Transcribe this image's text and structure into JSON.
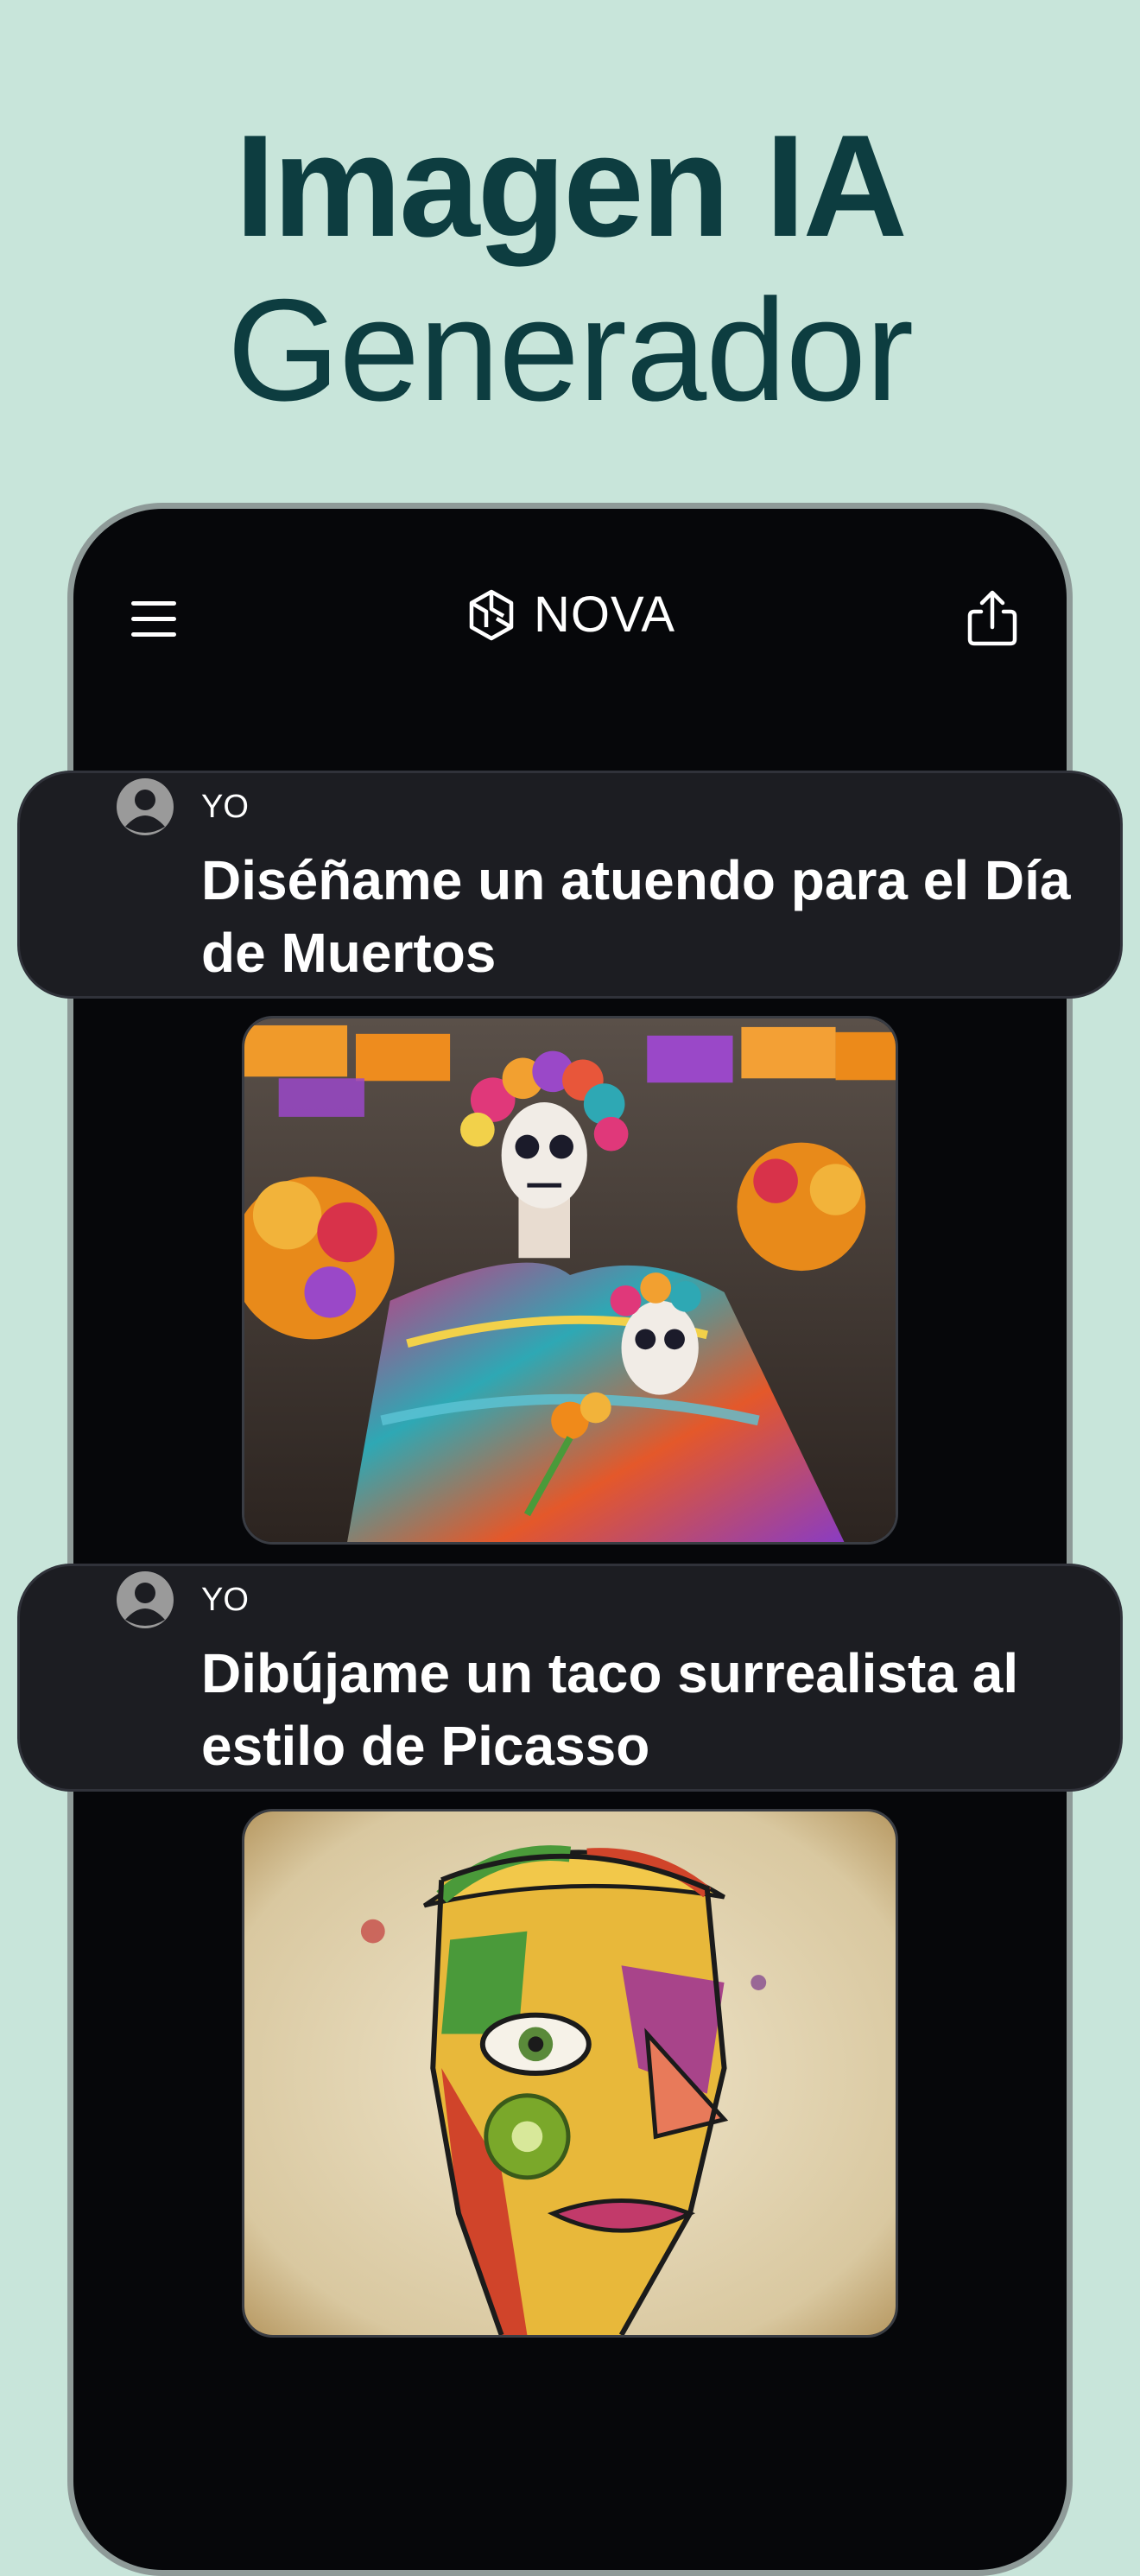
{
  "hero": {
    "title": "Imagen IA",
    "subtitle": "Generador"
  },
  "app": {
    "name": "NOVA",
    "icons": {
      "menu": "hamburger-menu-icon",
      "logo": "nova-logo-icon",
      "share": "share-icon",
      "avatar": "user-avatar-icon"
    }
  },
  "chat": {
    "messages": [
      {
        "sender": "YO",
        "prompt": "Diséñame un atuendo para el Día de Muertos",
        "image": "Catrina in floral dress with skull mask and marigolds"
      },
      {
        "sender": "YO",
        "prompt": "Dibújame un taco surrealista al estilo de Picasso",
        "image": "Cubist surreal taco face illustration"
      }
    ]
  },
  "colors": {
    "background": "#c8e5da",
    "hero_text": "#0d3d40",
    "phone_screen": "#06070a",
    "bubble": "#1c1d22"
  }
}
